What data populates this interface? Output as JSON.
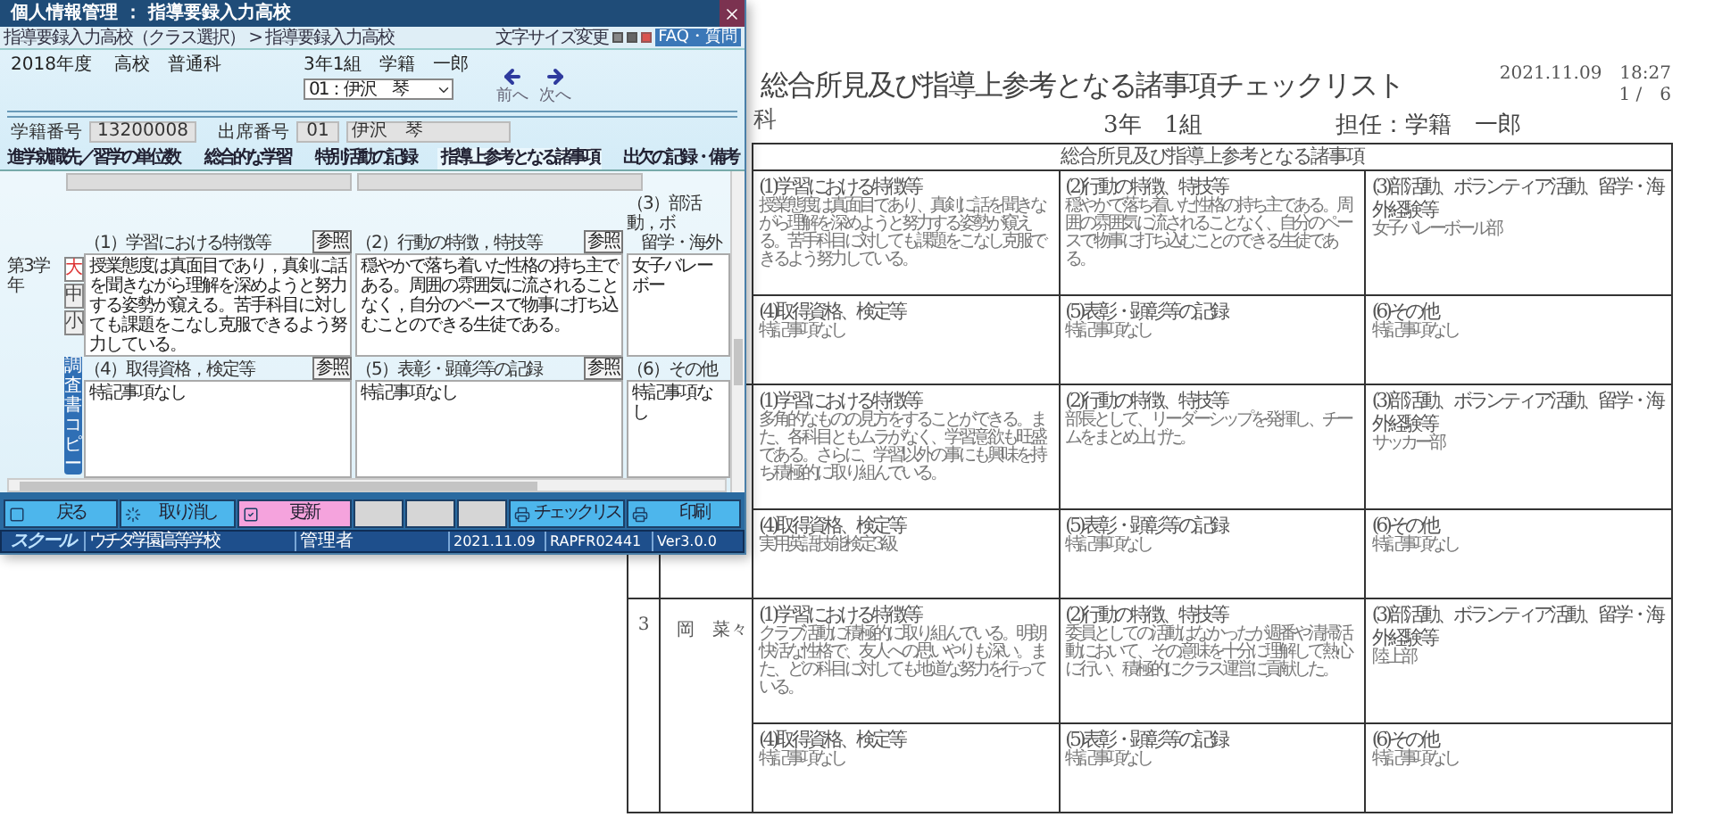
{
  "app_window": {
    "title": "個人情報管理 ： 指導要録入力高校",
    "breadcrumb": "指導要録入力高校（クラス選択） > 指導要録入力高校",
    "font_size_label": "文字サイズ変更",
    "help_button": "FAQ・質問",
    "year": "2018年度",
    "course": "高校　普通科",
    "class_label": "3年1組　学籍　一郎",
    "student_select": "01：伊沢　琴",
    "prev_label": "前へ",
    "next_label": "次へ",
    "student_number_label": "学籍番号",
    "student_number": "13200008",
    "attendance_number_label": "出席番号",
    "attendance_number": "01",
    "student_name": "伊沢　琴",
    "tabs": [
      {
        "label": "進学就職先／習学の単位数",
        "selected": false
      },
      {
        "label": "総合的な学習",
        "selected": false
      },
      {
        "label": "特別活動の記録",
        "selected": false
      },
      {
        "label": "指導上参考となる諸事項",
        "selected": true
      },
      {
        "label": "出欠の記録・備考",
        "selected": false
      }
    ],
    "grade_label": "第3学年",
    "size_buttons": [
      {
        "label": "大",
        "selected": true
      },
      {
        "label": "中",
        "selected": false
      },
      {
        "label": "小",
        "selected": false
      }
    ],
    "side_tab": "調査書コピー",
    "sections": [
      {
        "heading": "（1）学習における特徴等",
        "ref_button": "参照",
        "text": "授業態度は真面目であり，真剣に話を聞きながら理解を深めようと努力する姿勢が窺える。苦手科目に対しても課題をこなし克服できるよう努力している。"
      },
      {
        "heading": "（2）行動の特徴，特技等",
        "ref_button": "参照",
        "text": "穏やかで落ち着いた性格の持ち主である。周囲の雰囲気に流されることなく，自分のペースで物事に打ち込むことのできる生徒である。"
      },
      {
        "heading": "（3）部活動，ボ",
        "heading_continued": "留学・海外",
        "text": "女子バレーボー"
      },
      {
        "heading": "（4）取得資格，検定等",
        "ref_button": "参照",
        "text": "特記事項なし"
      },
      {
        "heading": "（5）表彰・顕彰等の記録",
        "ref_button": "参照",
        "text": "特記事項なし"
      },
      {
        "heading": "（6）その他",
        "text": "特記事項なし"
      }
    ],
    "buttons": [
      {
        "kind": "back",
        "label": "戻る"
      },
      {
        "kind": "cancel",
        "label": "取り消し"
      },
      {
        "kind": "update",
        "label": "更新"
      },
      {
        "kind": "blank"
      },
      {
        "kind": "blank"
      },
      {
        "kind": "blank"
      },
      {
        "kind": "checklist",
        "label": "チェックリス"
      },
      {
        "kind": "print",
        "label": "印刷"
      }
    ],
    "status_bar": {
      "logo": "スクール",
      "school": "ウチダ学園高等学校",
      "user": "管理者",
      "date": "2021.11.09",
      "program_id": "RAPFR02441",
      "version": "Ver3.0.0"
    }
  },
  "document": {
    "left_fragment": "科",
    "title": "総合所見及び指導上参考となる諸事項チェックリスト",
    "datetime": "2021.11.09　18:27",
    "page": "1 /　6",
    "class": "3年　1組",
    "teacher": "担任：学籍　一郎",
    "table_heading": "総合所見及び指導上参考となる諸事項",
    "students": [
      {
        "cells": [
          {
            "heading": "(1)学習における特徴等",
            "text": "授業態度は真面目であり、真剣に話を聞きながら理解を深めようと努力する姿勢が窺える。苦手科目に対しても課題をこなし克服できるよう努力している。"
          },
          {
            "heading": "(2)行動の特徴、特技等",
            "text": "穏やかで落ち着いた性格の持ち主である。周囲の雰囲気に流されることなく、自分のペースで物事に打ち込むことのできる生徒である。"
          },
          {
            "heading": "(3)部活動、ボランティア活動、留学・海外経験等",
            "text": "女子バレーボール部"
          },
          {
            "heading": "(4)取得資格、検定等",
            "text": "特記事項なし"
          },
          {
            "heading": "(5)表彰・顕彰等の記録",
            "text": "特記事項なし"
          },
          {
            "heading": "(6)その他",
            "text": "特記事項なし"
          }
        ]
      },
      {
        "cells": [
          {
            "heading": "(1)学習における特徴等",
            "text": "多角的なものの見方をすることができる。また、各科目ともムラがなく、学習意欲も旺盛である。さらに、学習以外の事にも興味を持ち積極的に取り組んでいる。"
          },
          {
            "heading": "(2)行動の特徴、特技等",
            "text": "部長として、リーダーシップを発揮し、チームをまとめ上げた。"
          },
          {
            "heading": "(3)部活動、ボランティア活動、留学・海外経験等",
            "text": "サッカー部"
          },
          {
            "heading": "(4)取得資格、検定等",
            "text": "実用英語技能検定3級"
          },
          {
            "heading": "(5)表彰・顕彰等の記録",
            "text": "特記事項なし"
          },
          {
            "heading": "(6)その他",
            "text": "特記事項なし"
          }
        ]
      },
      {
        "number": "3",
        "name": "岡　菜々",
        "cells": [
          {
            "heading": "(1)学習における特徴等",
            "text": "クラブ活動に積極的に取り組んでいる。明朗快活な性格で、友人への思いやりも深い。また、どの科目に対しても地道な努力を行っている。"
          },
          {
            "heading": "(2)行動の特徴、特技等",
            "text": "委員としての活動はなかったが週番や清掃活動において、その意味を十分に理解して熱心に行い、積極的にクラス運営に貢献した。"
          },
          {
            "heading": "(3)部活動、ボランティア活動、留学・海外経験等",
            "text": "陸上部"
          },
          {
            "heading": "(4)取得資格、検定等",
            "text": "特記事項なし"
          },
          {
            "heading": "(5)表彰・顕彰等の記録",
            "text": "特記事項なし"
          },
          {
            "heading": "(6)その他",
            "text": "特記事項なし"
          }
        ]
      }
    ]
  }
}
